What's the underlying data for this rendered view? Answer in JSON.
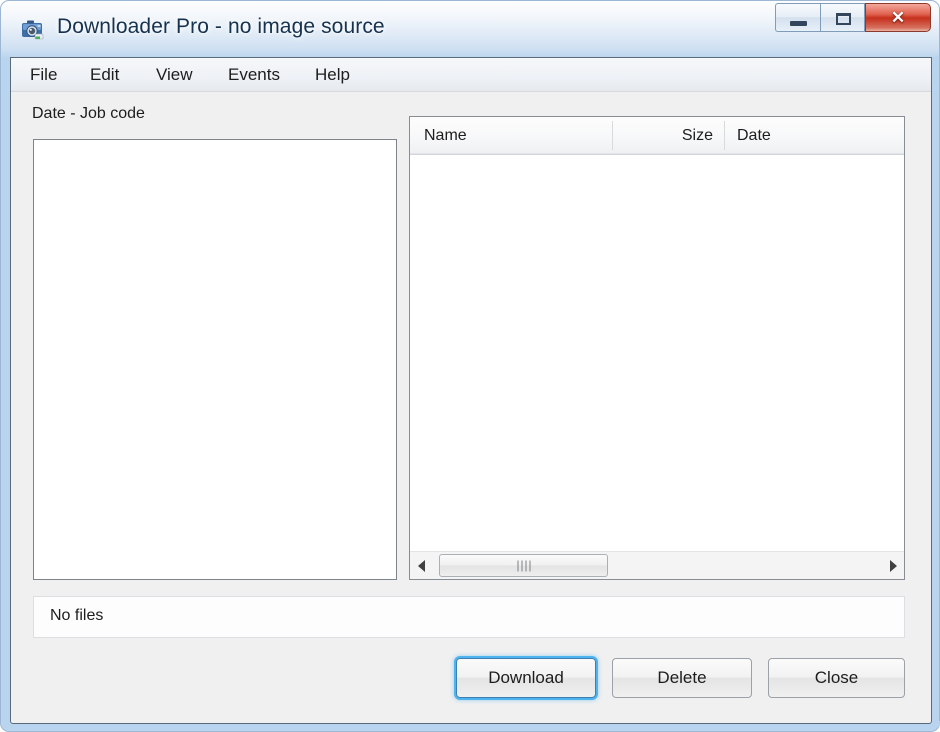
{
  "window": {
    "title": "Downloader Pro - no image source",
    "icon": "camera-icon",
    "controls": {
      "minimize_label": "–",
      "restore_label": "□",
      "close_label": "✕"
    },
    "frame_color": "#b9d4ee",
    "close_button_color": "#c5301c"
  },
  "menu": {
    "items": [
      {
        "label": "File"
      },
      {
        "label": "Edit"
      },
      {
        "label": "View"
      },
      {
        "label": "Events"
      },
      {
        "label": "Help"
      }
    ]
  },
  "left_panel": {
    "label": "Date - Job code",
    "items": []
  },
  "file_list": {
    "columns": [
      {
        "label": "Name",
        "align": "left"
      },
      {
        "label": "Size",
        "align": "right"
      },
      {
        "label": "Date",
        "align": "left"
      }
    ],
    "rows": []
  },
  "scrollbar": {
    "left_arrow": "arrow-left-icon",
    "right_arrow": "arrow-right-icon"
  },
  "status": {
    "text": "No files"
  },
  "buttons": {
    "download": "Download",
    "delete": "Delete",
    "close": "Close",
    "default_focus": "download",
    "focus_glow_color": "#4eb3ef"
  }
}
